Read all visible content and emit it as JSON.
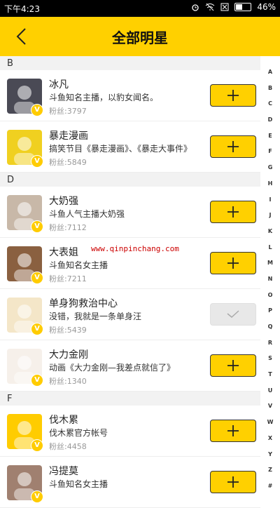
{
  "status_bar": {
    "time": "下午4:23",
    "battery": "46%"
  },
  "header": {
    "title": "全部明星"
  },
  "sections": [
    {
      "letter": "B",
      "items": [
        {
          "name": "冰凡",
          "desc": "斗鱼知名主播，以豹女闻名。",
          "fans": "粉丝:3797",
          "followed": false
        },
        {
          "name": "暴走漫画",
          "desc": "搞笑节目《暴走漫画》、《暴走大事件》",
          "fans": "粉丝:5849",
          "followed": false
        }
      ]
    },
    {
      "letter": "D",
      "items": [
        {
          "name": "大奶强",
          "desc": "斗鱼人气主播大奶强",
          "fans": "粉丝:7112",
          "followed": false
        },
        {
          "name": "大表姐",
          "desc": "斗鱼知名女主播",
          "fans": "粉丝:7211",
          "followed": false
        },
        {
          "name": "单身狗救治中心",
          "desc": "没错，我就是一条单身汪",
          "fans": "粉丝:5439",
          "followed": true
        },
        {
          "name": "大力金刚",
          "desc": "动画《大力金刚—我差点就信了》",
          "fans": "粉丝:1340",
          "followed": false
        }
      ]
    },
    {
      "letter": "F",
      "items": [
        {
          "name": "伐木累",
          "desc": "伐木累官方帐号",
          "fans": "粉丝:4458",
          "followed": false
        },
        {
          "name": "冯提莫",
          "desc": "斗鱼知名女主播",
          "fans": "",
          "followed": false
        }
      ]
    }
  ],
  "alphabet": [
    "A",
    "B",
    "C",
    "D",
    "E",
    "F",
    "G",
    "H",
    "I",
    "J",
    "K",
    "L",
    "M",
    "N",
    "O",
    "P",
    "Q",
    "R",
    "S",
    "T",
    "U",
    "V",
    "W",
    "X",
    "Y",
    "Z",
    "#"
  ],
  "badge_letter": "V",
  "watermark": "www.qinpinchang.com",
  "colors": {
    "accent": "#ffd000",
    "followed_button": "#e8e8e8"
  }
}
